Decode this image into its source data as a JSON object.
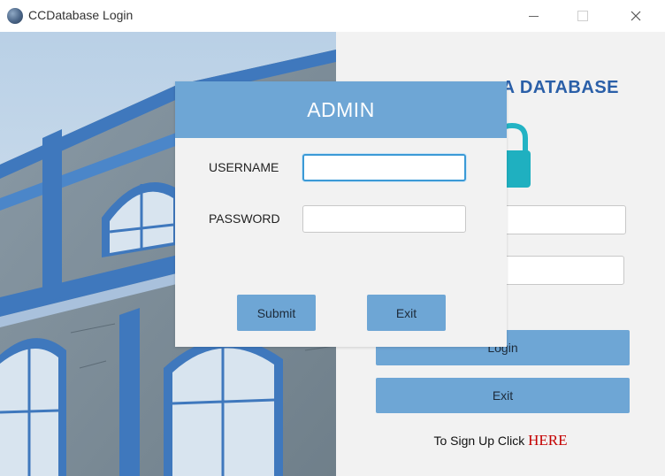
{
  "window": {
    "title": "CCDatabase Login",
    "icon": "database-globe-icon"
  },
  "login_panel": {
    "title": "A DATABASE",
    "username_value": "",
    "password_value": "",
    "login_label": "Login",
    "exit_label": "Exit",
    "signup_text": "To Sign Up Click ",
    "signup_link": "HERE"
  },
  "admin_dialog": {
    "title": "ADMIN",
    "username_label": "USERNAME",
    "password_label": "PASSWORD",
    "username_value": "",
    "password_value": "",
    "submit_label": "Submit",
    "exit_label": "Exit"
  },
  "colors": {
    "accent": "#6ea6d5",
    "title_blue": "#2a5fa8",
    "link_red": "#c40000",
    "panel_bg": "#f2f2f2"
  }
}
